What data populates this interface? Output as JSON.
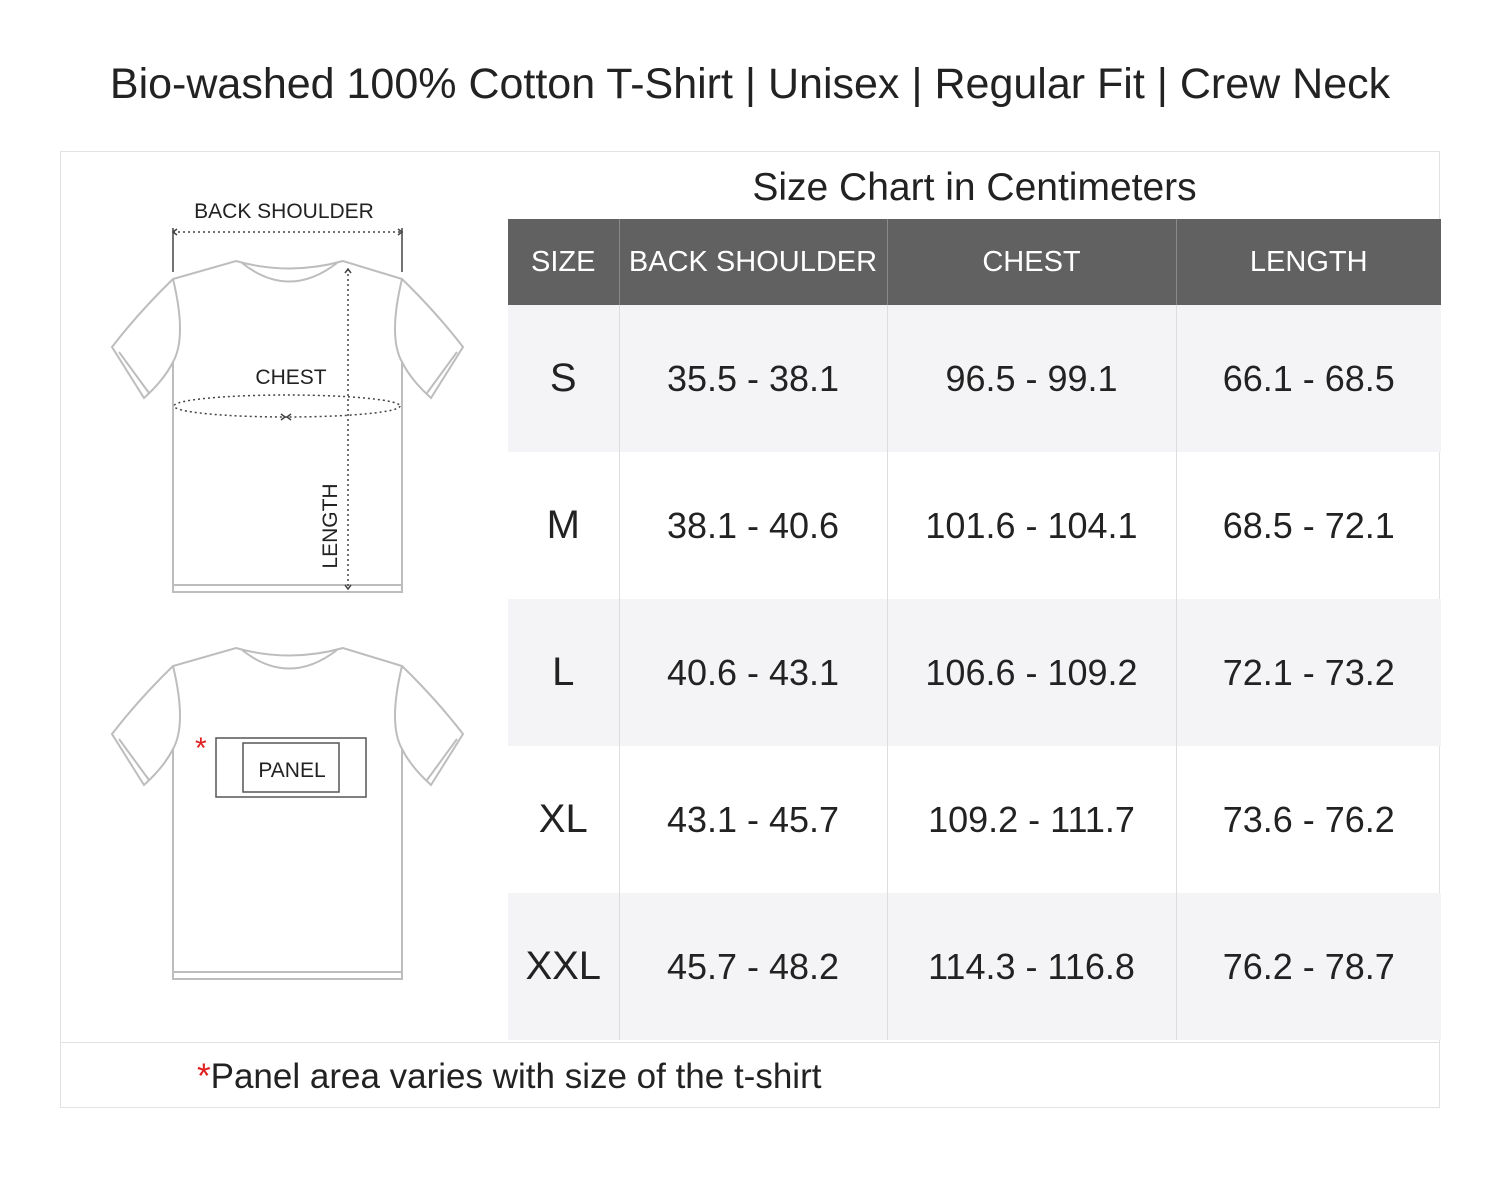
{
  "title": "Bio-washed 100% Cotton T-Shirt | Unisex | Regular Fit | Crew Neck",
  "diagram": {
    "back_shoulder_label": "BACK SHOULDER",
    "chest_label": "CHEST",
    "length_label": "LENGTH",
    "panel_label": "PANEL",
    "panel_marker": "*"
  },
  "size_chart": {
    "title": "Size Chart in Centimeters",
    "headers": [
      "SIZE",
      "BACK SHOULDER",
      "CHEST",
      "LENGTH"
    ],
    "rows": [
      [
        "S",
        "35.5 - 38.1",
        "96.5 - 99.1",
        "66.1 - 68.5"
      ],
      [
        "M",
        "38.1 - 40.6",
        "101.6 - 104.1",
        "68.5 - 72.1"
      ],
      [
        "L",
        "40.6 - 43.1",
        "106.6 - 109.2",
        "72.1 - 73.2"
      ],
      [
        "XL",
        "43.1 - 45.7",
        "109.2 - 111.7",
        "73.6 - 76.2"
      ],
      [
        "XXL",
        "45.7 - 48.2",
        "114.3 - 116.8",
        "76.2 - 78.7"
      ]
    ]
  },
  "footnote": {
    "marker": "*",
    "text": "Panel area varies with size of the t-shirt"
  },
  "colors": {
    "header_bg": "#616161",
    "row_shade": "#f4f4f6",
    "accent_red": "#e02020",
    "outline_gray": "#bdbdbd"
  }
}
